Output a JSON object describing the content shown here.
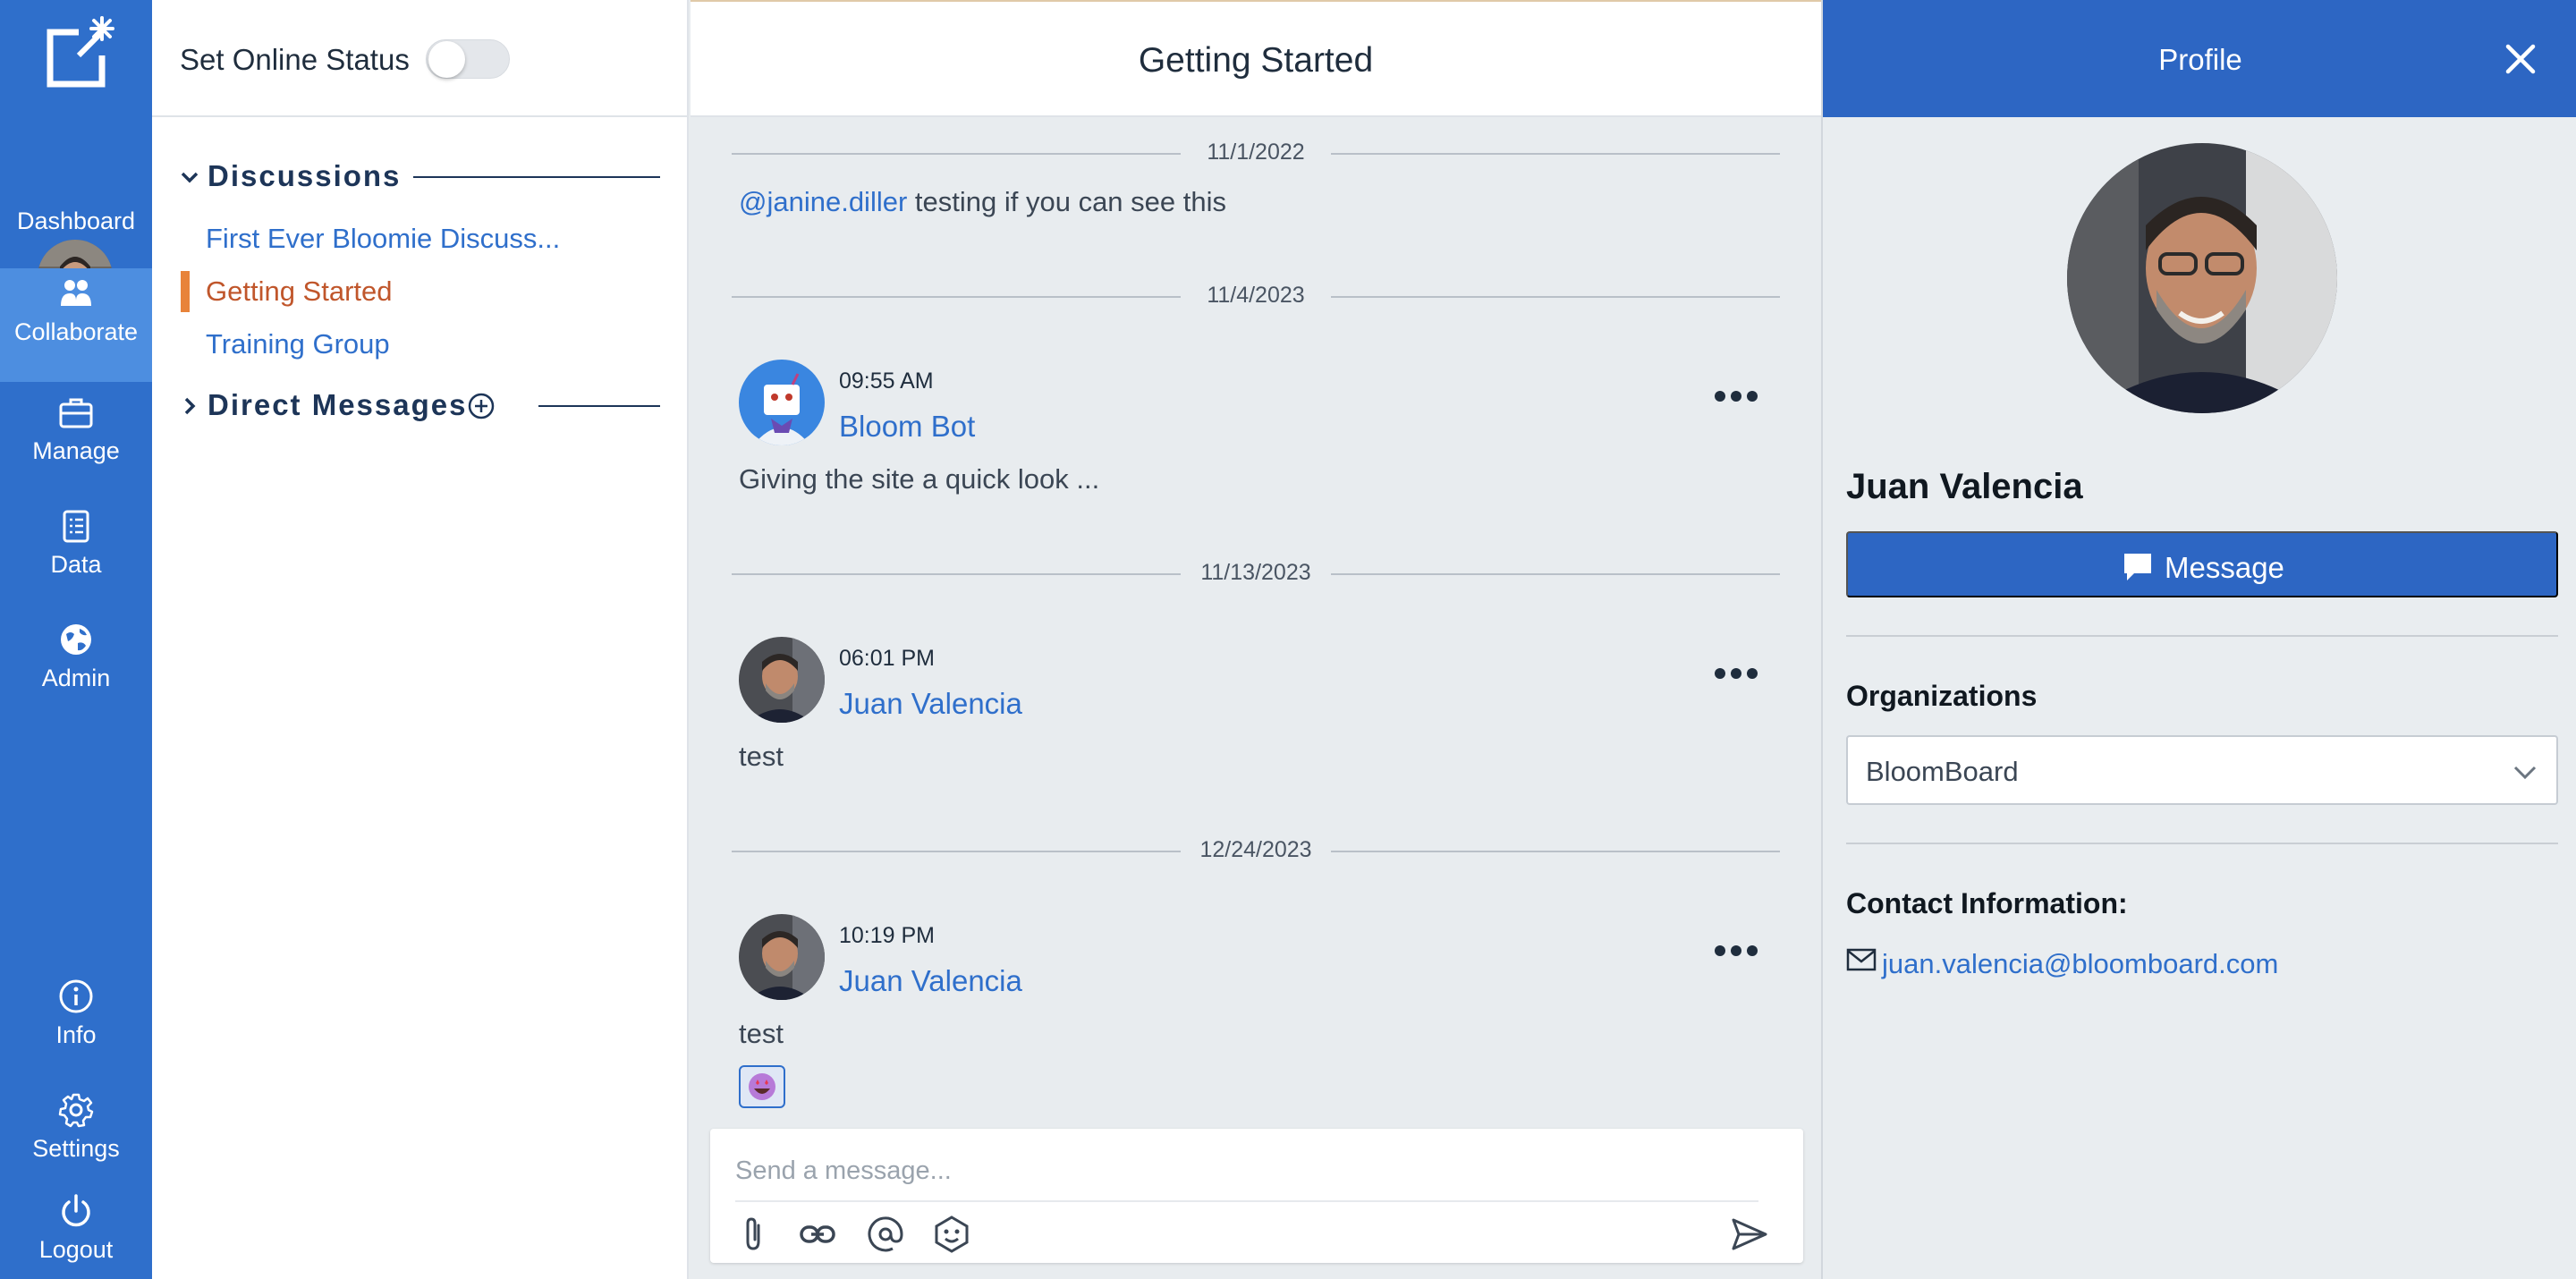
{
  "nav": {
    "items": [
      {
        "label": "Dashboard"
      },
      {
        "label": "Collaborate"
      },
      {
        "label": "Manage"
      },
      {
        "label": "Data"
      },
      {
        "label": "Admin"
      },
      {
        "label": "Info"
      },
      {
        "label": "Settings"
      },
      {
        "label": "Logout"
      }
    ],
    "active": "Collaborate",
    "accent_color": "#2f6fcb"
  },
  "sidebar": {
    "online_status_label": "Set Online Status",
    "online_status_on": false,
    "discussions_label": "Discussions",
    "channels": [
      {
        "label": "First Ever Bloomie Discuss..."
      },
      {
        "label": "Getting Started",
        "active": true
      },
      {
        "label": "Training Group"
      }
    ],
    "direct_messages_label": "Direct Messages"
  },
  "chat": {
    "title": "Getting Started",
    "dates": [
      "11/1/2022",
      "11/4/2023",
      "11/13/2023",
      "12/24/2023"
    ],
    "first_message": {
      "mention": "@janine.diller",
      "text": " testing if you can see this"
    },
    "messages": [
      {
        "time": "09:55 AM",
        "author": "Bloom Bot",
        "text": "Giving the site a quick look ..."
      },
      {
        "time": "06:01 PM",
        "author": "Juan Valencia",
        "text": "test"
      },
      {
        "time": "10:19 PM",
        "author": "Juan Valencia",
        "text": "test"
      }
    ],
    "composer": {
      "placeholder": "Send a message..."
    }
  },
  "profile": {
    "title": "Profile",
    "name": "Juan Valencia",
    "message_button": "Message",
    "organizations_label": "Organizations",
    "organization_selected": "BloomBoard",
    "contact_label": "Contact Information:",
    "email": "juan.valencia@bloomboard.com",
    "header_color": "#2d66c3"
  }
}
